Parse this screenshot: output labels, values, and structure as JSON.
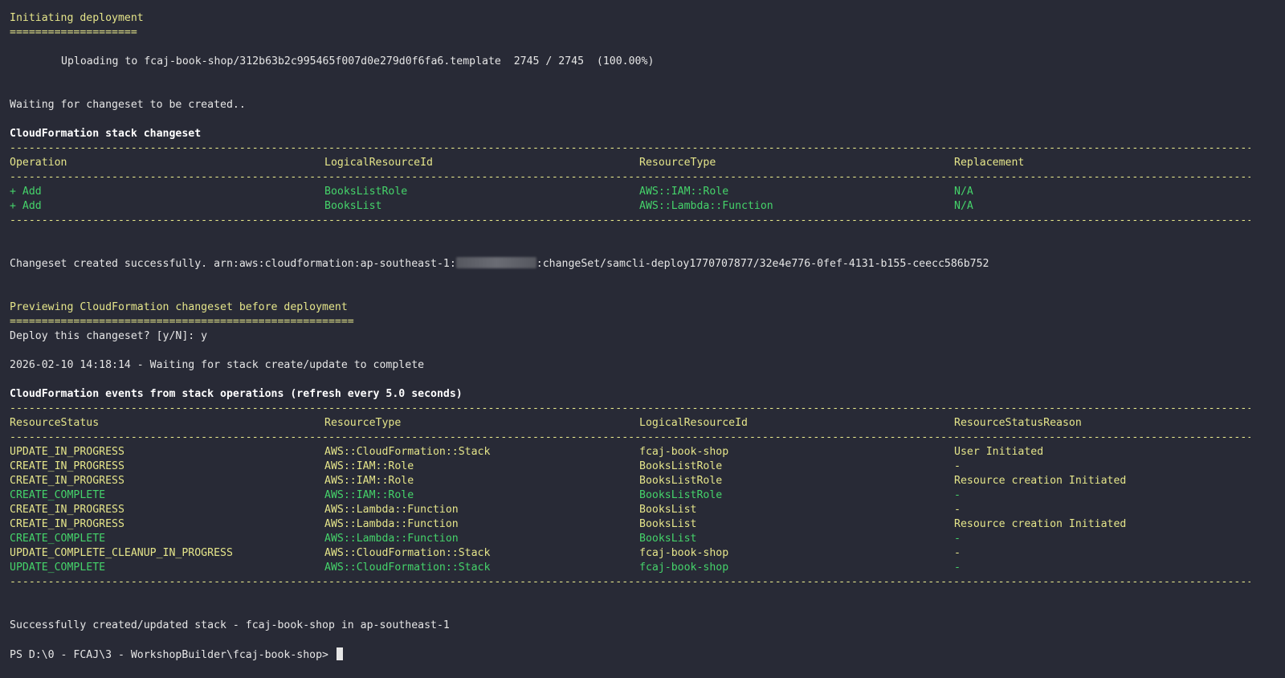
{
  "deploy_header": {
    "title": "Initiating deployment",
    "underline": "===================="
  },
  "upload_line": "Uploading to fcaj-book-shop/312b63b2c995465f007d0e279d0f6fa6.template  2745 / 2745  (100.00%)",
  "waiting_changeset": "Waiting for changeset to be created..",
  "changeset_table": {
    "title": "CloudFormation stack changeset",
    "headers": [
      "Operation",
      "LogicalResourceId",
      "ResourceType",
      "Replacement"
    ],
    "rows": [
      [
        "+ Add",
        "BooksListRole",
        "AWS::IAM::Role",
        "N/A"
      ],
      [
        "+ Add",
        "BooksList",
        "AWS::Lambda::Function",
        "N/A"
      ]
    ]
  },
  "changeset_created": {
    "prefix": "Changeset created successfully. arn:aws:cloudformation:ap-southeast-1:",
    "suffix": ":changeSet/samcli-deploy1770707877/32e4e776-0fef-4131-b155-ceecc586b752"
  },
  "preview_header": {
    "title": "Previewing CloudFormation changeset before deployment",
    "underline": "======================================================"
  },
  "deploy_prompt": "Deploy this changeset? [y/N]: y",
  "waiting_stack": "2026-02-10 14:18:14 - Waiting for stack create/update to complete",
  "events_table": {
    "title": "CloudFormation events from stack operations (refresh every 5.0 seconds)",
    "headers": [
      "ResourceStatus",
      "ResourceType",
      "LogicalResourceId",
      "ResourceStatusReason"
    ],
    "rows": [
      {
        "cells": [
          "UPDATE_IN_PROGRESS",
          "AWS::CloudFormation::Stack",
          "fcaj-book-shop",
          "User Initiated"
        ],
        "color": "yellow"
      },
      {
        "cells": [
          "CREATE_IN_PROGRESS",
          "AWS::IAM::Role",
          "BooksListRole",
          "-"
        ],
        "color": "yellow"
      },
      {
        "cells": [
          "CREATE_IN_PROGRESS",
          "AWS::IAM::Role",
          "BooksListRole",
          "Resource creation Initiated"
        ],
        "color": "yellow"
      },
      {
        "cells": [
          "CREATE_COMPLETE",
          "AWS::IAM::Role",
          "BooksListRole",
          "-"
        ],
        "color": "green"
      },
      {
        "cells": [
          "CREATE_IN_PROGRESS",
          "AWS::Lambda::Function",
          "BooksList",
          "-"
        ],
        "color": "yellow"
      },
      {
        "cells": [
          "CREATE_IN_PROGRESS",
          "AWS::Lambda::Function",
          "BooksList",
          "Resource creation Initiated"
        ],
        "color": "yellow"
      },
      {
        "cells": [
          "CREATE_COMPLETE",
          "AWS::Lambda::Function",
          "BooksList",
          "-"
        ],
        "color": "green"
      },
      {
        "cells": [
          "UPDATE_COMPLETE_CLEANUP_IN_PROGRESS",
          "AWS::CloudFormation::Stack",
          "fcaj-book-shop",
          "-"
        ],
        "color": "yellow"
      },
      {
        "cells": [
          "UPDATE_COMPLETE",
          "AWS::CloudFormation::Stack",
          "fcaj-book-shop",
          "-"
        ],
        "color": "green"
      }
    ]
  },
  "success_line": "Successfully created/updated stack - fcaj-book-shop in ap-southeast-1",
  "prompt": "PS D:\\0 - FCAJ\\3 - WorkshopBuilder\\fcaj-book-shop> ",
  "colors": {
    "background": "#282a36",
    "yellow": "#e5e58a",
    "green": "#45d36a",
    "text": "#e6e6e6"
  }
}
